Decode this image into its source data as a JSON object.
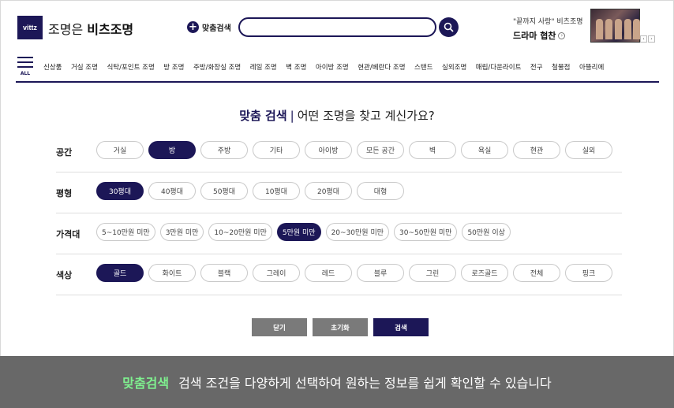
{
  "header": {
    "logo_mark": "vittz",
    "logo_prefix": "조명은",
    "logo_brand": "비츠조명",
    "custom_search_label": "맞춤검색",
    "search_placeholder": "",
    "promo_sub": "\"끝까지 사랑\" 비츠조명",
    "promo_main": "드라마 협찬",
    "promo_prev": "‹",
    "promo_next": "›"
  },
  "nav": {
    "menu_all": "ALL",
    "categories": [
      "신상품",
      "거실 조명",
      "식탁/포인트 조명",
      "방 조명",
      "주방/화장실 조명",
      "레일 조명",
      "벽 조명",
      "아이방 조명",
      "현관/베란다 조명",
      "스탠드",
      "실외조명",
      "매립/다운라이트",
      "전구",
      "철물점",
      "아뜰리에"
    ]
  },
  "panel": {
    "title_strong": "맞춤 검색",
    "title_sep": "|",
    "title_rest": "어떤 조명을 찾고 계신가요?"
  },
  "filters": {
    "space": {
      "label": "공간",
      "options": [
        "거실",
        "방",
        "주방",
        "기타",
        "아이방",
        "모든 공간",
        "벽",
        "욕실",
        "현관",
        "실외"
      ],
      "selected": "방"
    },
    "size": {
      "label": "평형",
      "options": [
        "30평대",
        "40평대",
        "50평대",
        "10평대",
        "20평대",
        "대형"
      ],
      "selected": "30평대"
    },
    "price": {
      "label": "가격대",
      "options": [
        "5~10만원 미만",
        "3만원 미만",
        "10~20만원 미만",
        "5만원 미만",
        "20~30만원 미만",
        "30~50만원 미만",
        "50만원 이상"
      ],
      "selected": "5만원 미만"
    },
    "color": {
      "label": "색상",
      "options": [
        "골드",
        "화이트",
        "블랙",
        "그레이",
        "레드",
        "블루",
        "그린",
        "로즈골드",
        "전체",
        "핑크"
      ],
      "selected": "골드"
    }
  },
  "actions": {
    "close": "닫기",
    "reset": "초기화",
    "search": "검색"
  },
  "banner": {
    "highlight": "맞춤검색",
    "text": "검색 조건을 다양하게 선택하여 원하는 정보를 쉽게 확인할 수 있습니다"
  },
  "colors": {
    "brand": "#1c1757",
    "banner_bg": "#686868",
    "banner_highlight": "#7ff08f"
  }
}
